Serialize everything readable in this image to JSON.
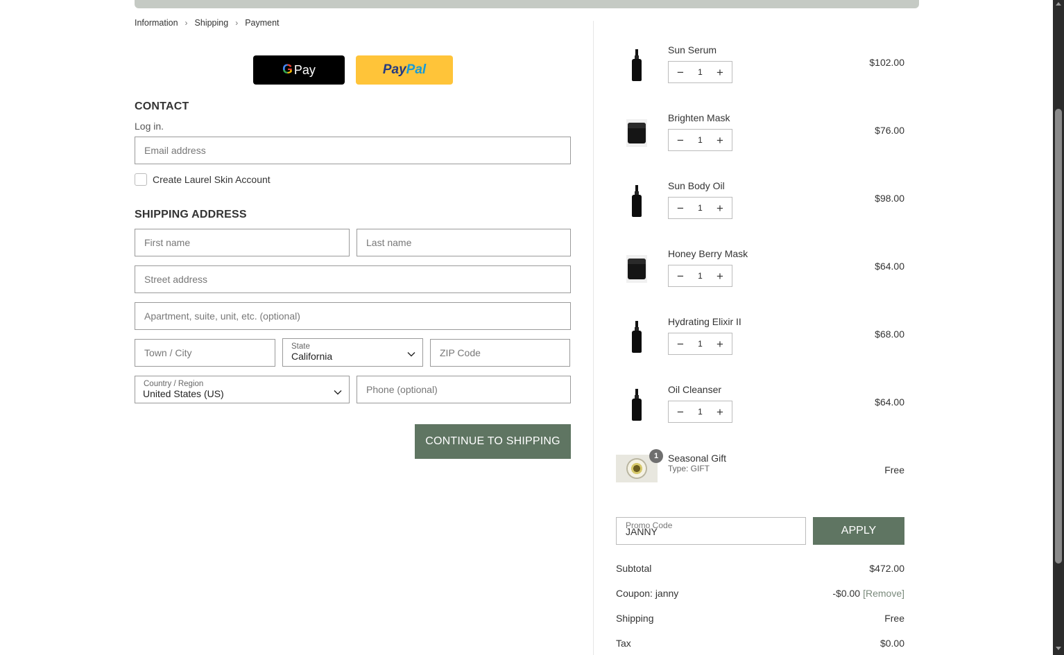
{
  "breadcrumb": {
    "step1": "Information",
    "step2": "Shipping",
    "step3": "Payment"
  },
  "express": {
    "gpay_label": "Pay",
    "paypal_a": "Pay",
    "paypal_b": "Pal"
  },
  "contact": {
    "title": "CONTACT",
    "login_link": "Log in.",
    "email_placeholder": "Email address",
    "create_account_label": "Create Laurel Skin Account"
  },
  "shipping": {
    "title": "SHIPPING ADDRESS",
    "first_name_placeholder": "First name",
    "last_name_placeholder": "Last name",
    "street_placeholder": "Street address",
    "apartment_placeholder": "Apartment, suite, unit, etc. (optional)",
    "city_placeholder": "Town / City",
    "state_label": "State",
    "state_value": "California",
    "zip_placeholder": "ZIP Code",
    "country_label": "Country / Region",
    "country_value": "United States (US)",
    "phone_placeholder": "Phone (optional)",
    "continue_label": "CONTINUE TO SHIPPING"
  },
  "cart": {
    "items": [
      {
        "name": "Sun Serum",
        "qty": "1",
        "price": "$102.00",
        "kind": "bottle"
      },
      {
        "name": "Brighten Mask",
        "qty": "1",
        "price": "$76.00",
        "kind": "jar"
      },
      {
        "name": "Sun Body Oil",
        "qty": "1",
        "price": "$98.00",
        "kind": "bottle"
      },
      {
        "name": "Honey Berry Mask",
        "qty": "1",
        "price": "$64.00",
        "kind": "jar"
      },
      {
        "name": "Hydrating Elixir II",
        "qty": "1",
        "price": "$68.00",
        "kind": "bottle"
      },
      {
        "name": "Oil Cleanser",
        "qty": "1",
        "price": "$64.00",
        "kind": "bottle"
      }
    ],
    "gift": {
      "badge": "1",
      "name": "Seasonal Gift",
      "type": "Type: GIFT",
      "price": "Free"
    },
    "qty_minus": "−",
    "qty_plus": "+"
  },
  "promo": {
    "label": "Promo Code",
    "value": "JANNY",
    "apply_label": "APPLY"
  },
  "summary": {
    "subtotal_label": "Subtotal",
    "subtotal_value": "$472.00",
    "coupon_label": "Coupon: janny",
    "coupon_value": "-$0.00",
    "coupon_remove": "[Remove]",
    "shipping_label": "Shipping",
    "shipping_value": "Free",
    "tax_label": "Tax",
    "tax_value": "$0.00"
  },
  "colors": {
    "accent": "#5f7562",
    "topbar": "#c5cac4",
    "paypal_bg": "#ffc439"
  }
}
